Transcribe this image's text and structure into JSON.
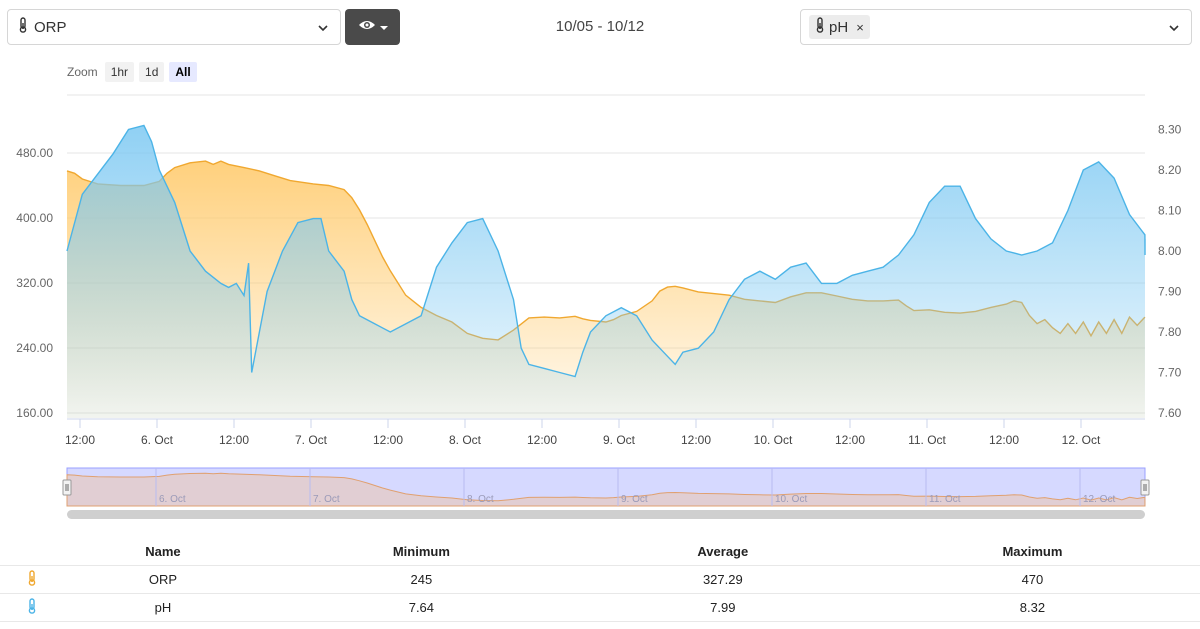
{
  "header": {
    "primary_sensor": "ORP",
    "date_range": "10/05 - 10/12",
    "compare_tag": "pH",
    "tag_remove": "×"
  },
  "zoom": {
    "label": "Zoom",
    "buttons": [
      "1hr",
      "1d",
      "All"
    ],
    "active": "All"
  },
  "colors": {
    "orp": "#f0a830",
    "ph": "#4cb4e7",
    "navigator": "#c9ccff"
  },
  "icons": {
    "sensor": "thermometer-icon",
    "visibility": "eye-icon",
    "dropdown": "chevron-down-icon"
  },
  "chart_data": {
    "type": "area",
    "x_labels": [
      "12:00",
      "6. Oct",
      "12:00",
      "7. Oct",
      "12:00",
      "8. Oct",
      "12:00",
      "9. Oct",
      "12:00",
      "10. Oct",
      "12:00",
      "11. Oct",
      "12:00",
      "12. Oct"
    ],
    "x_range_days": [
      0,
      7.0
    ],
    "y_left": {
      "ticks": [
        "160.00",
        "240.00",
        "320.00",
        "400.00",
        "480.00"
      ],
      "min": 160,
      "max": 480
    },
    "y_right": {
      "ticks": [
        "7.60",
        "7.70",
        "7.80",
        "7.90",
        "8.00",
        "8.10",
        "8.20",
        "8.30"
      ],
      "min": 7.6,
      "max": 8.3
    },
    "series": [
      {
        "name": "ORP",
        "axis": "left",
        "points": [
          [
            0,
            458
          ],
          [
            0.05,
            455
          ],
          [
            0.1,
            448
          ],
          [
            0.2,
            442
          ],
          [
            0.35,
            440
          ],
          [
            0.5,
            440
          ],
          [
            0.6,
            445
          ],
          [
            0.65,
            455
          ],
          [
            0.7,
            462
          ],
          [
            0.8,
            468
          ],
          [
            0.9,
            470
          ],
          [
            0.95,
            466
          ],
          [
            1.0,
            470
          ],
          [
            1.05,
            466
          ],
          [
            1.15,
            462
          ],
          [
            1.25,
            458
          ],
          [
            1.35,
            452
          ],
          [
            1.45,
            446
          ],
          [
            1.6,
            442
          ],
          [
            1.7,
            440
          ],
          [
            1.8,
            435
          ],
          [
            1.85,
            425
          ],
          [
            1.9,
            410
          ],
          [
            1.95,
            392
          ],
          [
            2.0,
            372
          ],
          [
            2.05,
            352
          ],
          [
            2.1,
            335
          ],
          [
            2.15,
            320
          ],
          [
            2.2,
            305
          ],
          [
            2.3,
            290
          ],
          [
            2.4,
            280
          ],
          [
            2.5,
            272
          ],
          [
            2.6,
            258
          ],
          [
            2.7,
            252
          ],
          [
            2.8,
            250
          ],
          [
            2.9,
            262
          ],
          [
            3.0,
            277
          ],
          [
            3.1,
            278
          ],
          [
            3.2,
            277
          ],
          [
            3.3,
            279
          ],
          [
            3.35,
            276
          ],
          [
            3.4,
            274
          ],
          [
            3.5,
            272
          ],
          [
            3.55,
            275
          ],
          [
            3.6,
            280
          ],
          [
            3.7,
            285
          ],
          [
            3.8,
            298
          ],
          [
            3.85,
            310
          ],
          [
            3.9,
            315
          ],
          [
            3.95,
            316
          ],
          [
            4.0,
            314
          ],
          [
            4.1,
            309
          ],
          [
            4.2,
            307
          ],
          [
            4.3,
            305
          ],
          [
            4.4,
            300
          ],
          [
            4.5,
            298
          ],
          [
            4.6,
            296
          ],
          [
            4.7,
            303
          ],
          [
            4.8,
            308
          ],
          [
            4.9,
            308
          ],
          [
            5.0,
            304
          ],
          [
            5.1,
            300
          ],
          [
            5.2,
            298
          ],
          [
            5.3,
            298
          ],
          [
            5.4,
            299
          ],
          [
            5.45,
            292
          ],
          [
            5.5,
            286
          ],
          [
            5.6,
            287
          ],
          [
            5.7,
            284
          ],
          [
            5.8,
            283
          ],
          [
            5.9,
            285
          ],
          [
            6.0,
            290
          ],
          [
            6.1,
            294
          ],
          [
            6.15,
            298
          ],
          [
            6.2,
            296
          ],
          [
            6.25,
            280
          ],
          [
            6.3,
            270
          ],
          [
            6.35,
            275
          ],
          [
            6.4,
            265
          ],
          [
            6.45,
            258
          ],
          [
            6.5,
            270
          ],
          [
            6.55,
            258
          ],
          [
            6.6,
            272
          ],
          [
            6.65,
            255
          ],
          [
            6.7,
            272
          ],
          [
            6.75,
            258
          ],
          [
            6.8,
            275
          ],
          [
            6.85,
            258
          ],
          [
            6.9,
            278
          ],
          [
            6.95,
            268
          ],
          [
            7.0,
            278
          ]
        ]
      },
      {
        "name": "pH",
        "axis": "right",
        "points": [
          [
            0,
            8.0
          ],
          [
            0.1,
            8.14
          ],
          [
            0.2,
            8.19
          ],
          [
            0.3,
            8.24
          ],
          [
            0.4,
            8.3
          ],
          [
            0.5,
            8.31
          ],
          [
            0.55,
            8.27
          ],
          [
            0.6,
            8.2
          ],
          [
            0.7,
            8.12
          ],
          [
            0.8,
            8.0
          ],
          [
            0.9,
            7.95
          ],
          [
            1.0,
            7.92
          ],
          [
            1.05,
            7.91
          ],
          [
            1.1,
            7.92
          ],
          [
            1.15,
            7.89
          ],
          [
            1.18,
            7.97
          ],
          [
            1.2,
            7.7
          ],
          [
            1.25,
            7.8
          ],
          [
            1.3,
            7.9
          ],
          [
            1.4,
            8.0
          ],
          [
            1.5,
            8.07
          ],
          [
            1.6,
            8.08
          ],
          [
            1.65,
            8.08
          ],
          [
            1.7,
            8.0
          ],
          [
            1.8,
            7.95
          ],
          [
            1.85,
            7.88
          ],
          [
            1.9,
            7.84
          ],
          [
            2.0,
            7.82
          ],
          [
            2.1,
            7.8
          ],
          [
            2.2,
            7.82
          ],
          [
            2.3,
            7.84
          ],
          [
            2.35,
            7.9
          ],
          [
            2.4,
            7.96
          ],
          [
            2.5,
            8.02
          ],
          [
            2.6,
            8.07
          ],
          [
            2.7,
            8.08
          ],
          [
            2.8,
            8.0
          ],
          [
            2.9,
            7.88
          ],
          [
            2.95,
            7.76
          ],
          [
            3.0,
            7.72
          ],
          [
            3.1,
            7.71
          ],
          [
            3.2,
            7.7
          ],
          [
            3.3,
            7.69
          ],
          [
            3.35,
            7.75
          ],
          [
            3.4,
            7.8
          ],
          [
            3.5,
            7.84
          ],
          [
            3.6,
            7.86
          ],
          [
            3.7,
            7.84
          ],
          [
            3.8,
            7.78
          ],
          [
            3.9,
            7.74
          ],
          [
            3.95,
            7.72
          ],
          [
            4.0,
            7.75
          ],
          [
            4.1,
            7.76
          ],
          [
            4.2,
            7.8
          ],
          [
            4.3,
            7.88
          ],
          [
            4.4,
            7.93
          ],
          [
            4.5,
            7.95
          ],
          [
            4.6,
            7.93
          ],
          [
            4.7,
            7.96
          ],
          [
            4.8,
            7.97
          ],
          [
            4.9,
            7.92
          ],
          [
            5.0,
            7.92
          ],
          [
            5.1,
            7.94
          ],
          [
            5.2,
            7.95
          ],
          [
            5.3,
            7.96
          ],
          [
            5.4,
            7.99
          ],
          [
            5.5,
            8.04
          ],
          [
            5.6,
            8.12
          ],
          [
            5.7,
            8.16
          ],
          [
            5.8,
            8.16
          ],
          [
            5.9,
            8.08
          ],
          [
            6.0,
            8.03
          ],
          [
            6.1,
            8.0
          ],
          [
            6.2,
            7.99
          ],
          [
            6.3,
            8.0
          ],
          [
            6.4,
            8.02
          ],
          [
            6.5,
            8.1
          ],
          [
            6.6,
            8.2
          ],
          [
            6.7,
            8.22
          ],
          [
            6.8,
            8.18
          ],
          [
            6.9,
            8.09
          ],
          [
            7.0,
            8.04
          ],
          [
            7.1,
            8.01
          ],
          [
            7.2,
            7.99
          ],
          [
            7.3,
            8.0
          ],
          [
            7.35,
            8.03
          ]
        ]
      }
    ]
  },
  "navigator": {
    "labels": [
      "6. Oct",
      "7. Oct",
      "8. Oct",
      "9. Oct",
      "10. Oct",
      "11. Oct",
      "12. Oct"
    ]
  },
  "table": {
    "headers": [
      "Name",
      "Minimum",
      "Average",
      "Maximum"
    ],
    "rows": [
      {
        "name": "ORP",
        "min": "245",
        "avg": "327.29",
        "max": "470"
      },
      {
        "name": "pH",
        "min": "7.64",
        "avg": "7.99",
        "max": "8.32"
      }
    ]
  }
}
